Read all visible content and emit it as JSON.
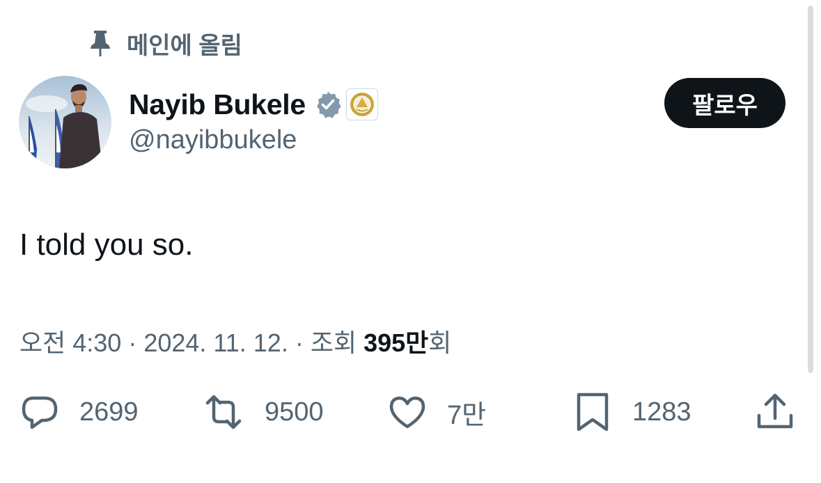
{
  "pinned": {
    "label": "메인에 올림",
    "icon": "pin-icon"
  },
  "author": {
    "name": "Nayib Bukele",
    "handle": "@nayibbukele",
    "verified_icon": "verified-badge-icon",
    "affiliate_icon": "el-salvador-seal-icon"
  },
  "follow_button": {
    "label": "팔로우"
  },
  "tweet": {
    "text": "I told you so."
  },
  "meta": {
    "time": "오전 4:30",
    "separator": " · ",
    "date": "2024. 11. 12.",
    "views_label": "조회 ",
    "views_count": "395만",
    "views_suffix": "회"
  },
  "actions": {
    "replies": "2699",
    "reposts": "9500",
    "likes": "7만",
    "bookmarks": "1283"
  },
  "colors": {
    "text_primary": "#0f1419",
    "text_secondary": "#536471",
    "verified_badge": "#829aab",
    "button_bg": "#0f1419"
  }
}
